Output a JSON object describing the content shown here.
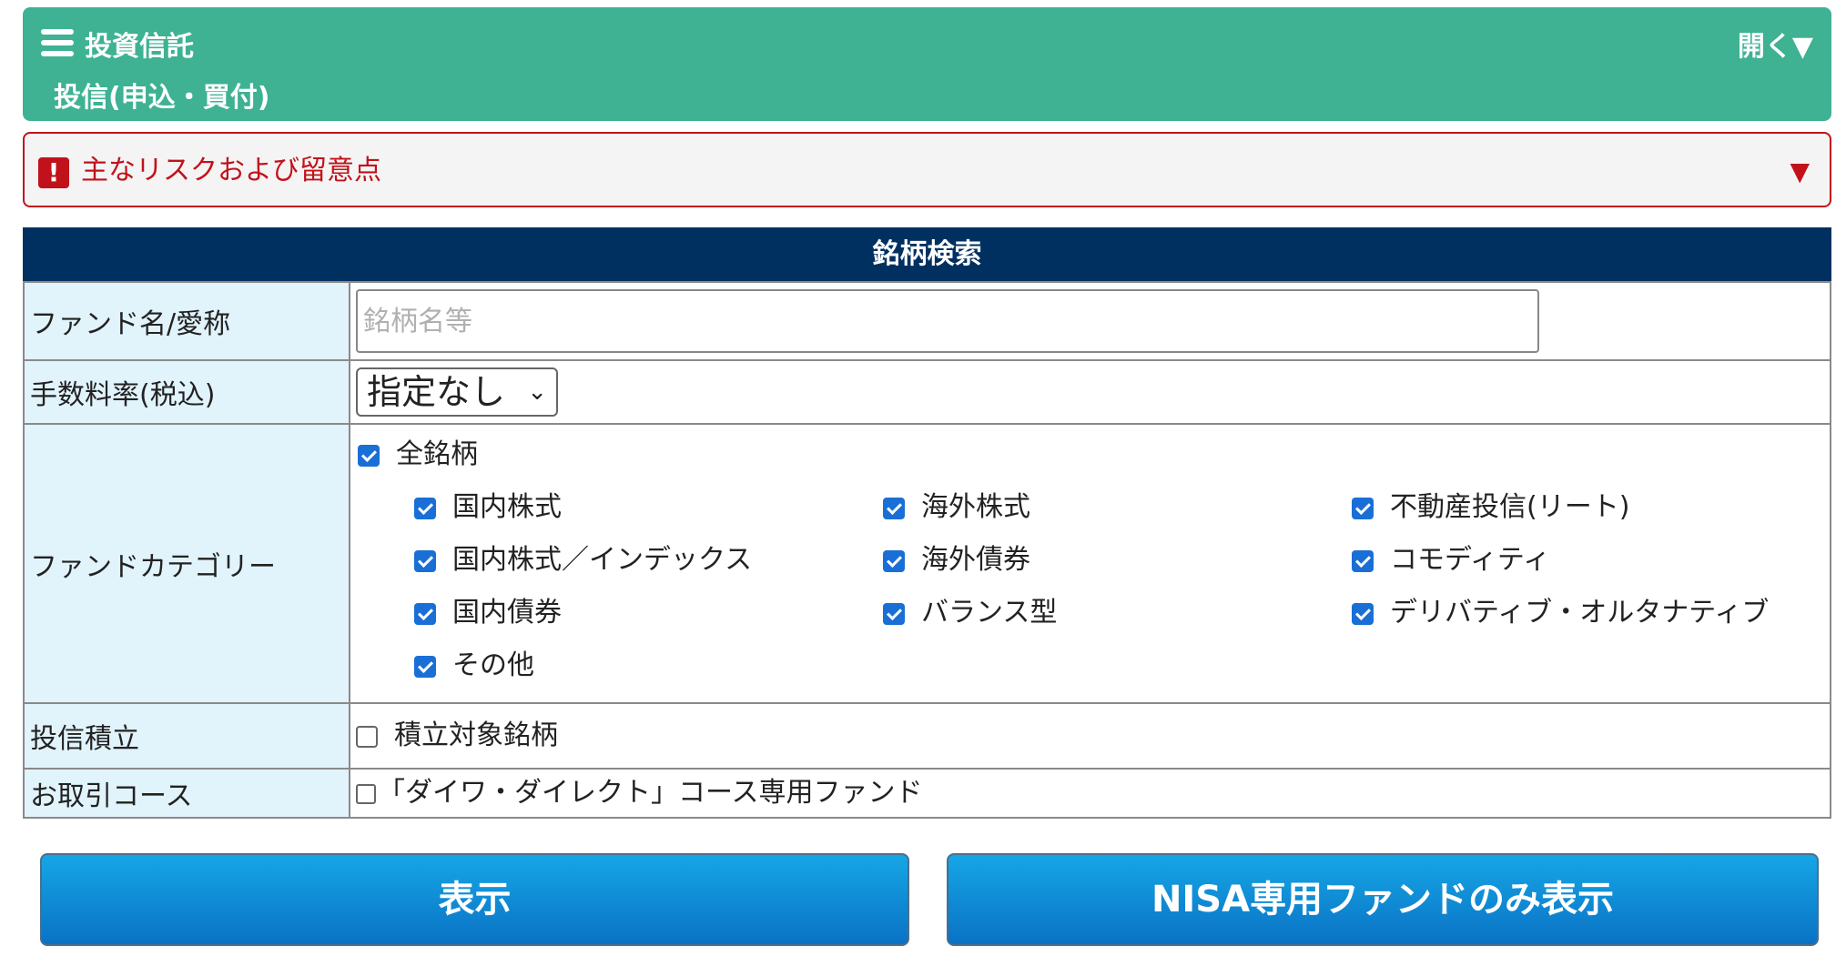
{
  "header": {
    "title": "投資信託",
    "subtitle": "投信(申込・買付)",
    "toggle_label": "開く▼"
  },
  "risk": {
    "icon": "!",
    "label": "主なリスクおよび留意点",
    "arrow": "▼"
  },
  "search": {
    "title": "銘柄検索",
    "fund_name": {
      "label": "ファンド名/愛称",
      "placeholder": "銘柄名等",
      "value": ""
    },
    "fee": {
      "label": "手数料率(税込)",
      "selected": "指定なし"
    },
    "category": {
      "label": "ファンドカテゴリー",
      "all": {
        "label": "全銘柄",
        "checked": true
      },
      "items": [
        {
          "label": "国内株式",
          "checked": true
        },
        {
          "label": "海外株式",
          "checked": true
        },
        {
          "label": "不動産投信(リート)",
          "checked": true
        },
        {
          "label": "国内株式／インデックス",
          "checked": true
        },
        {
          "label": "海外債券",
          "checked": true
        },
        {
          "label": "コモディティ",
          "checked": true
        },
        {
          "label": "国内債券",
          "checked": true
        },
        {
          "label": "バランス型",
          "checked": true
        },
        {
          "label": "デリバティブ・オルタナティブ",
          "checked": true
        },
        {
          "label": "その他",
          "checked": true
        }
      ]
    },
    "accumulation": {
      "label": "投信積立",
      "option_label": "積立対象銘柄",
      "checked": false
    },
    "course": {
      "label": "お取引コース",
      "option_label": "「ダイワ・ダイレクト」コース専用ファンド",
      "checked": false
    }
  },
  "buttons": {
    "show": "表示",
    "nisa_only": "NISA専用ファンドのみ表示"
  },
  "colors": {
    "header_bg": "#3eb293",
    "risk_red": "#c1121b",
    "table_header_bg": "#003060",
    "label_bg": "#e1f3fb",
    "checkbox_blue": "#1a6fd6",
    "button_blue": "#0a72c4"
  }
}
